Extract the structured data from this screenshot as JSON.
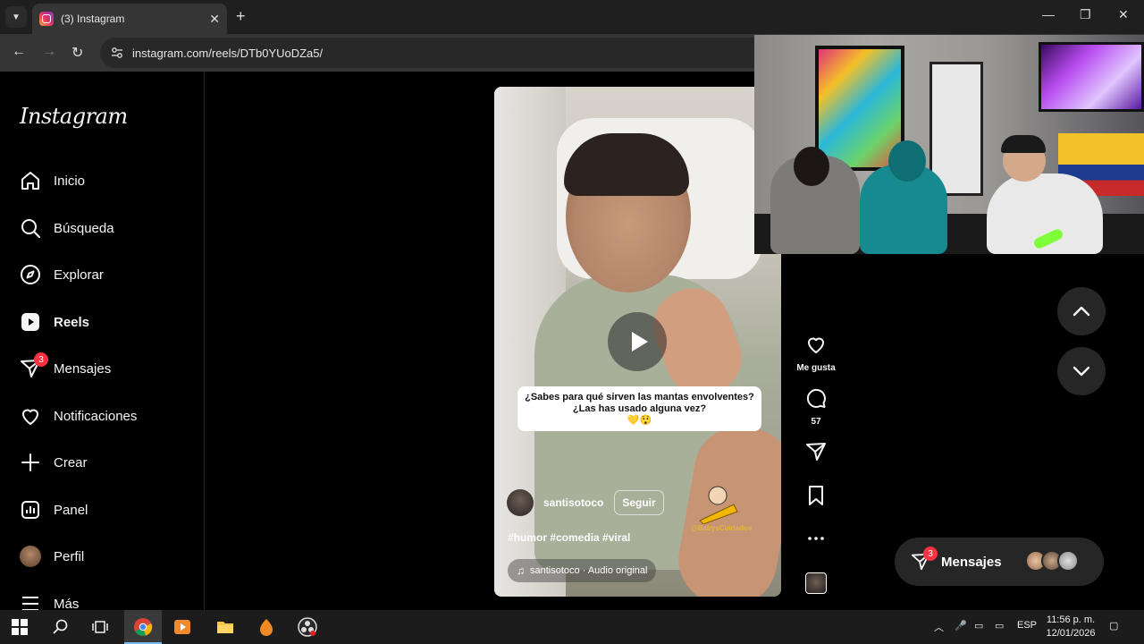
{
  "browser": {
    "tab_title": "(3) Instagram",
    "url": "instagram.com/reels/DTb0YUoDZa5/"
  },
  "sidebar": {
    "logo": "Instagram",
    "items": [
      {
        "label": "Inicio",
        "icon": "home-icon"
      },
      {
        "label": "Búsqueda",
        "icon": "search-icon"
      },
      {
        "label": "Explorar",
        "icon": "compass-icon"
      },
      {
        "label": "Reels",
        "icon": "reels-icon"
      },
      {
        "label": "Mensajes",
        "icon": "messenger-icon",
        "badge": "3"
      },
      {
        "label": "Notificaciones",
        "icon": "heart-icon"
      },
      {
        "label": "Crear",
        "icon": "plus-icon"
      },
      {
        "label": "Panel",
        "icon": "dashboard-icon"
      },
      {
        "label": "Perfil",
        "icon": "avatar"
      },
      {
        "label": "Más",
        "icon": "menu-icon"
      }
    ]
  },
  "reel": {
    "caption_line1": "¿Sabes para qué sirven las mantas envolventes?",
    "caption_line2": "¿Las has usado alguna vez?",
    "caption_emoji": "💛😲",
    "author": "santisotoco",
    "follow_label": "Seguir",
    "hashtags": "#humor #comedia #viral",
    "audio": "santisotoco · Audio original",
    "sticker_caption": "@BabysCuidados"
  },
  "actions": {
    "like_label": "Me gusta",
    "comments_count": "57"
  },
  "messages_pill": {
    "label": "Mensajes",
    "badge": "3"
  },
  "taskbar": {
    "language": "ESP",
    "time": "11:56 p. m.",
    "date": "12/01/2026"
  },
  "colors": {
    "badge": "#ff3040",
    "background": "#000000",
    "panel": "#262626"
  }
}
